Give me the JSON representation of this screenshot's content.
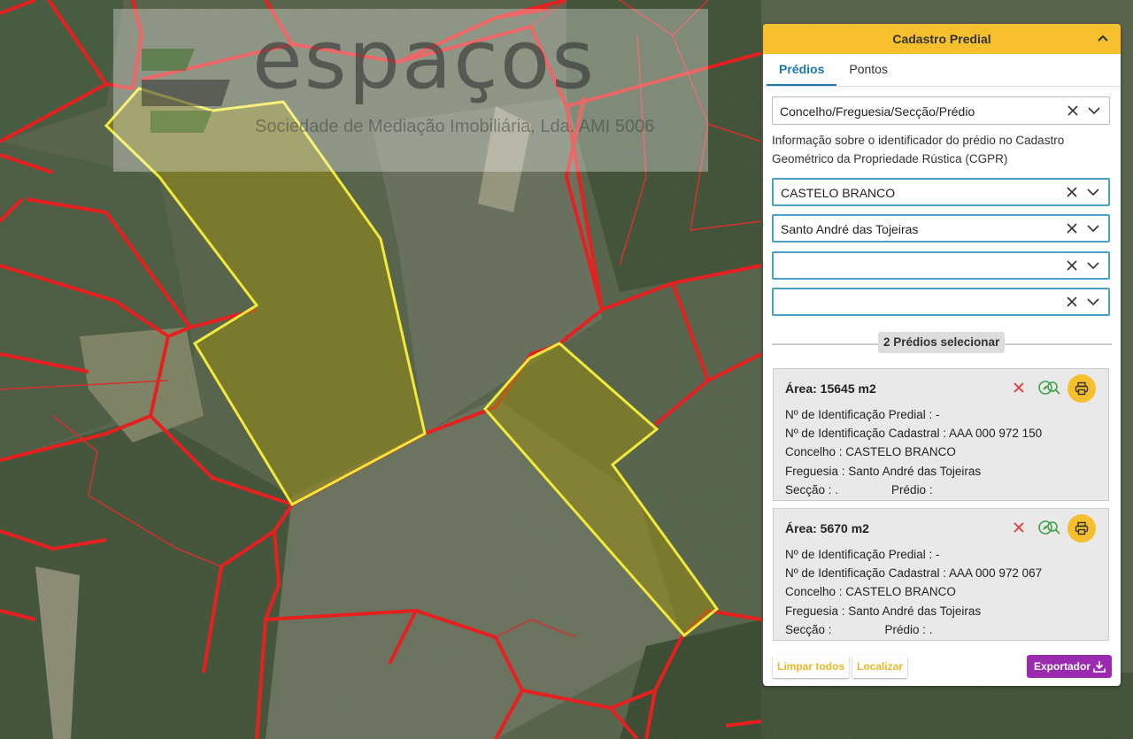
{
  "watermark": {
    "title": "espaços",
    "subtitle": "Sociedade de Mediação Imobiliária, Lda.  AMI 5006"
  },
  "panel": {
    "title": "Cadastro Predial",
    "tabs": [
      {
        "label": "Prédios",
        "active": true
      },
      {
        "label": "Pontos",
        "active": false
      }
    ],
    "type_select": "Concelho/Freguesia/Secção/Prédio",
    "info": "Informação sobre o identificador do prédio no Cadastro Geométrico da Propriedade Rústica (CGPR)",
    "concelho": "CASTELO BRANCO",
    "freguesia": "Santo André das Tojeiras",
    "seccao": "",
    "predio": "",
    "selection_label": "2 Prédios selecionar",
    "cards": [
      {
        "area": "Área: 15645 m2",
        "line1": "Nº de Identificação Predial : -",
        "line2": "Nº de Identificação Cadastral : AAA 000 972 150",
        "line3": "Concelho : CASTELO BRANCO",
        "line4": "Freguesia : Santo André das Tojeiras",
        "seccao_label": "Secção : .",
        "predio_label": "Prédio :"
      },
      {
        "area": "Área: 5670 m2",
        "line1": "Nº de Identificação Predial : -",
        "line2": "Nº de Identificação Cadastral : AAA 000 972 067",
        "line3": "Concelho : CASTELO BRANCO",
        "line4": "Freguesia : Santo André das Tojeiras",
        "seccao_label": "Secção :",
        "predio_label": "Prédio : ."
      }
    ],
    "buttons": {
      "clear": "Limpar todos",
      "locate": "Localizar",
      "export": "Exportador"
    }
  },
  "colors": {
    "accent": "#f6bf2d",
    "tab_active": "#1a79b4",
    "export": "#9a2bb0",
    "parcel_line": "#e5201f",
    "selected_outline": "#f2ea3a"
  },
  "icons": [
    "chevron-up-icon",
    "clear-x-icon",
    "chevron-down-icon",
    "delete-x-icon",
    "zoom-search-icon",
    "compass-icon",
    "printer-icon",
    "download-icon"
  ]
}
